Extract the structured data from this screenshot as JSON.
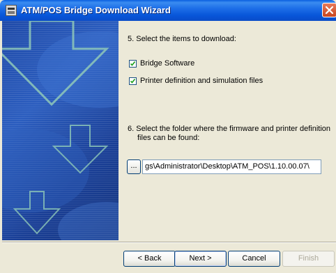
{
  "window": {
    "title": "ATM/POS Bridge Download Wizard"
  },
  "step5": {
    "label": "5.  Select the items to download:",
    "items": [
      {
        "label": "Bridge Software",
        "checked": true
      },
      {
        "label": "Printer definition and simulation files",
        "checked": true
      }
    ]
  },
  "step6": {
    "label_line1": "6.  Select the folder where the firmware and printer definition",
    "label_line2": "files can be found:",
    "browse_label": "...",
    "path_value": "gs\\Administrator\\Desktop\\ATM_POS\\1.10.00.07\\"
  },
  "buttons": {
    "back": "< Back",
    "next": "Next >",
    "cancel": "Cancel",
    "finish": "Finish"
  },
  "icons": {
    "title": "wizard-app-icon",
    "close": "close-icon",
    "check": "check-icon",
    "arrow": "down-arrow-icon"
  },
  "colors": {
    "titlebar": "#0755d8",
    "side_panel": "#1f4aa8",
    "close_button": "#c9461f",
    "dialog_bg": "#ece9d8"
  }
}
